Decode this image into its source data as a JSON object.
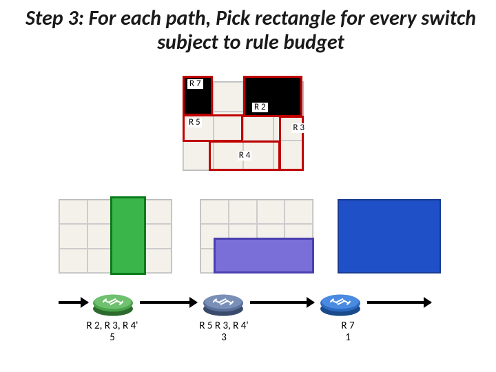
{
  "title": "Step 3: For each path, Pick rectangle for every switch subject to rule budget",
  "top_rects": {
    "r7": "R 7",
    "r2": "R 2",
    "r5": "R 5",
    "r3": "R 3",
    "r4": "R 4"
  },
  "switches": [
    {
      "rules": "R 2, R 3, R 4'",
      "count": "5"
    },
    {
      "rules": "R 5 R 3, R 4'",
      "count": "3"
    },
    {
      "rules": "R 7",
      "count": "1"
    }
  ],
  "colors": {
    "rect_border": "#c00000",
    "green": "#39b54a",
    "purple": "#7a6fd8",
    "blue": "#2050c8"
  }
}
